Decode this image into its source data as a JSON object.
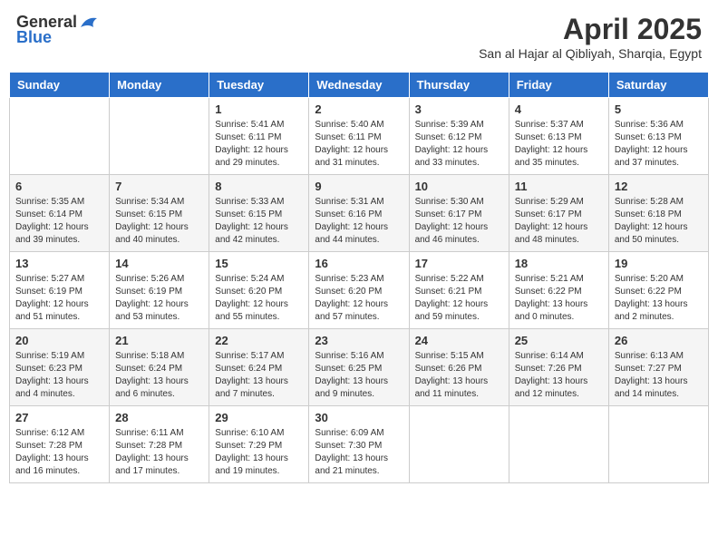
{
  "logo": {
    "general": "General",
    "blue": "Blue"
  },
  "title": "April 2025",
  "subtitle": "San al Hajar al Qibliyah, Sharqia, Egypt",
  "days": [
    "Sunday",
    "Monday",
    "Tuesday",
    "Wednesday",
    "Thursday",
    "Friday",
    "Saturday"
  ],
  "weeks": [
    [
      {
        "day": "",
        "info": ""
      },
      {
        "day": "",
        "info": ""
      },
      {
        "day": "1",
        "info": "Sunrise: 5:41 AM\nSunset: 6:11 PM\nDaylight: 12 hours and 29 minutes."
      },
      {
        "day": "2",
        "info": "Sunrise: 5:40 AM\nSunset: 6:11 PM\nDaylight: 12 hours and 31 minutes."
      },
      {
        "day": "3",
        "info": "Sunrise: 5:39 AM\nSunset: 6:12 PM\nDaylight: 12 hours and 33 minutes."
      },
      {
        "day": "4",
        "info": "Sunrise: 5:37 AM\nSunset: 6:13 PM\nDaylight: 12 hours and 35 minutes."
      },
      {
        "day": "5",
        "info": "Sunrise: 5:36 AM\nSunset: 6:13 PM\nDaylight: 12 hours and 37 minutes."
      }
    ],
    [
      {
        "day": "6",
        "info": "Sunrise: 5:35 AM\nSunset: 6:14 PM\nDaylight: 12 hours and 39 minutes."
      },
      {
        "day": "7",
        "info": "Sunrise: 5:34 AM\nSunset: 6:15 PM\nDaylight: 12 hours and 40 minutes."
      },
      {
        "day": "8",
        "info": "Sunrise: 5:33 AM\nSunset: 6:15 PM\nDaylight: 12 hours and 42 minutes."
      },
      {
        "day": "9",
        "info": "Sunrise: 5:31 AM\nSunset: 6:16 PM\nDaylight: 12 hours and 44 minutes."
      },
      {
        "day": "10",
        "info": "Sunrise: 5:30 AM\nSunset: 6:17 PM\nDaylight: 12 hours and 46 minutes."
      },
      {
        "day": "11",
        "info": "Sunrise: 5:29 AM\nSunset: 6:17 PM\nDaylight: 12 hours and 48 minutes."
      },
      {
        "day": "12",
        "info": "Sunrise: 5:28 AM\nSunset: 6:18 PM\nDaylight: 12 hours and 50 minutes."
      }
    ],
    [
      {
        "day": "13",
        "info": "Sunrise: 5:27 AM\nSunset: 6:19 PM\nDaylight: 12 hours and 51 minutes."
      },
      {
        "day": "14",
        "info": "Sunrise: 5:26 AM\nSunset: 6:19 PM\nDaylight: 12 hours and 53 minutes."
      },
      {
        "day": "15",
        "info": "Sunrise: 5:24 AM\nSunset: 6:20 PM\nDaylight: 12 hours and 55 minutes."
      },
      {
        "day": "16",
        "info": "Sunrise: 5:23 AM\nSunset: 6:20 PM\nDaylight: 12 hours and 57 minutes."
      },
      {
        "day": "17",
        "info": "Sunrise: 5:22 AM\nSunset: 6:21 PM\nDaylight: 12 hours and 59 minutes."
      },
      {
        "day": "18",
        "info": "Sunrise: 5:21 AM\nSunset: 6:22 PM\nDaylight: 13 hours and 0 minutes."
      },
      {
        "day": "19",
        "info": "Sunrise: 5:20 AM\nSunset: 6:22 PM\nDaylight: 13 hours and 2 minutes."
      }
    ],
    [
      {
        "day": "20",
        "info": "Sunrise: 5:19 AM\nSunset: 6:23 PM\nDaylight: 13 hours and 4 minutes."
      },
      {
        "day": "21",
        "info": "Sunrise: 5:18 AM\nSunset: 6:24 PM\nDaylight: 13 hours and 6 minutes."
      },
      {
        "day": "22",
        "info": "Sunrise: 5:17 AM\nSunset: 6:24 PM\nDaylight: 13 hours and 7 minutes."
      },
      {
        "day": "23",
        "info": "Sunrise: 5:16 AM\nSunset: 6:25 PM\nDaylight: 13 hours and 9 minutes."
      },
      {
        "day": "24",
        "info": "Sunrise: 5:15 AM\nSunset: 6:26 PM\nDaylight: 13 hours and 11 minutes."
      },
      {
        "day": "25",
        "info": "Sunrise: 6:14 AM\nSunset: 7:26 PM\nDaylight: 13 hours and 12 minutes."
      },
      {
        "day": "26",
        "info": "Sunrise: 6:13 AM\nSunset: 7:27 PM\nDaylight: 13 hours and 14 minutes."
      }
    ],
    [
      {
        "day": "27",
        "info": "Sunrise: 6:12 AM\nSunset: 7:28 PM\nDaylight: 13 hours and 16 minutes."
      },
      {
        "day": "28",
        "info": "Sunrise: 6:11 AM\nSunset: 7:28 PM\nDaylight: 13 hours and 17 minutes."
      },
      {
        "day": "29",
        "info": "Sunrise: 6:10 AM\nSunset: 7:29 PM\nDaylight: 13 hours and 19 minutes."
      },
      {
        "day": "30",
        "info": "Sunrise: 6:09 AM\nSunset: 7:30 PM\nDaylight: 13 hours and 21 minutes."
      },
      {
        "day": "",
        "info": ""
      },
      {
        "day": "",
        "info": ""
      },
      {
        "day": "",
        "info": ""
      }
    ]
  ]
}
